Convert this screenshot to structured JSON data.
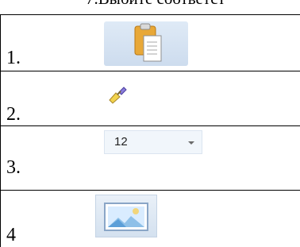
{
  "heading": "7.Выбите соответст",
  "rows": [
    {
      "number": "1.",
      "icon": "paste-icon"
    },
    {
      "number": "2.",
      "icon": "format-painter-icon"
    },
    {
      "number": "3.",
      "icon": "font-size-dropdown",
      "value": "12"
    },
    {
      "number": "4",
      "icon": "insert-picture-icon"
    }
  ]
}
